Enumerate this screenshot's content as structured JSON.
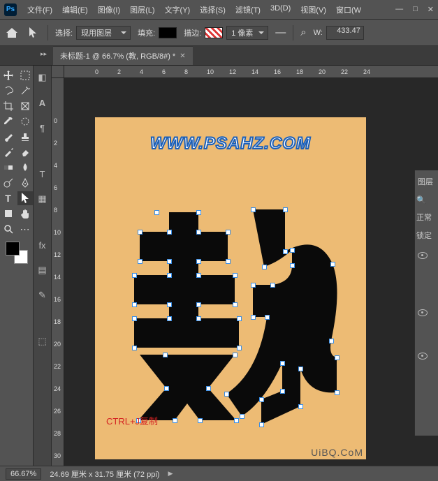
{
  "app": {
    "logo": "Ps"
  },
  "menu": [
    "文件(F)",
    "编辑(E)",
    "图像(I)",
    "图层(L)",
    "文字(Y)",
    "选择(S)",
    "滤镜(T)",
    "3D(D)",
    "视图(V)",
    "窗口(W"
  ],
  "window_controls": {
    "min": "—",
    "restore": "□",
    "close": "✕"
  },
  "options": {
    "select_label": "选择:",
    "select_value": "现用图层",
    "fill_label": "填充:",
    "stroke_label": "描边:",
    "stroke_width": "1 像素",
    "w_label": "W:",
    "w_value": "433.47"
  },
  "tab": {
    "title": "未标题-1 @ 66.7% (教, RGB/8#) *"
  },
  "ruler_h": [
    "0",
    "2",
    "4",
    "6",
    "8",
    "10",
    "12",
    "14",
    "16",
    "18",
    "20",
    "22",
    "24"
  ],
  "ruler_v": [
    "0",
    "2",
    "4",
    "6",
    "8",
    "10",
    "12",
    "14",
    "16",
    "18",
    "20",
    "22",
    "24",
    "26",
    "28",
    "30"
  ],
  "canvas": {
    "watermark": "WWW.PSAHZ.COM",
    "annotation": "CTRL+J复制",
    "credit": "UiBQ.CoM"
  },
  "right_panel": {
    "title": "图层",
    "normal": "正常",
    "lock": "锁定"
  },
  "status": {
    "zoom": "66.67%",
    "info": "24.69 厘米 x 31.75 厘米 (72 ppi)"
  }
}
